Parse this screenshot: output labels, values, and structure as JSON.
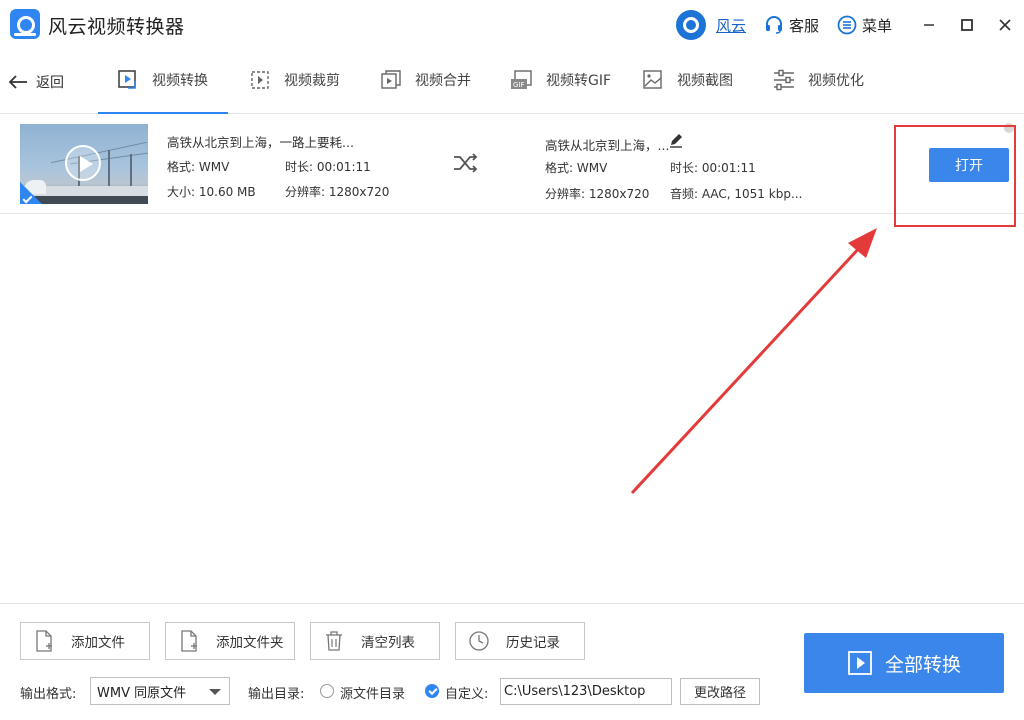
{
  "app": {
    "title": "风云视频转换器"
  },
  "topbar": {
    "brand_label": "风云",
    "service_label": "客服",
    "menu_label": "菜单"
  },
  "nav": {
    "back_label": "返回",
    "tabs": [
      {
        "label": "视频转换",
        "icon": "video-convert-icon",
        "active": true
      },
      {
        "label": "视频裁剪",
        "icon": "video-crop-icon",
        "active": false
      },
      {
        "label": "视频合并",
        "icon": "video-merge-icon",
        "active": false
      },
      {
        "label": "视频转GIF",
        "icon": "gif-icon",
        "active": false
      },
      {
        "label": "视频截图",
        "icon": "screenshot-icon",
        "active": false
      },
      {
        "label": "视频优化",
        "icon": "optimize-icon",
        "active": false
      }
    ]
  },
  "file": {
    "source": {
      "name": "高铁从北京到上海，一路上要耗...",
      "format": "格式: WMV",
      "duration": "时长: 00:01:11",
      "size": "大小: 10.60 MB",
      "resolution": "分辨率: 1280x720"
    },
    "output": {
      "name": "高铁从北京到上海，...",
      "format": "格式: WMV",
      "duration": "时长: 00:01:11",
      "resolution": "分辨率: 1280x720",
      "audio": "音频: AAC, 1051 kbp..."
    },
    "open_label": "打开"
  },
  "toolbar": {
    "add_file": "添加文件",
    "add_folder": "添加文件夹",
    "clear_list": "清空列表",
    "history": "历史记录",
    "convert_all": "全部转换"
  },
  "output": {
    "format_label": "输出格式:",
    "format_value": "WMV 同原文件",
    "dir_label": "输出目录:",
    "source_dir_label": "源文件目录",
    "custom_label": "自定义:",
    "path_value": "C:\\Users\\123\\Desktop",
    "change_path_label": "更改路径"
  },
  "colors": {
    "accent": "#3b86ea",
    "annotation": "#e53a3a"
  }
}
